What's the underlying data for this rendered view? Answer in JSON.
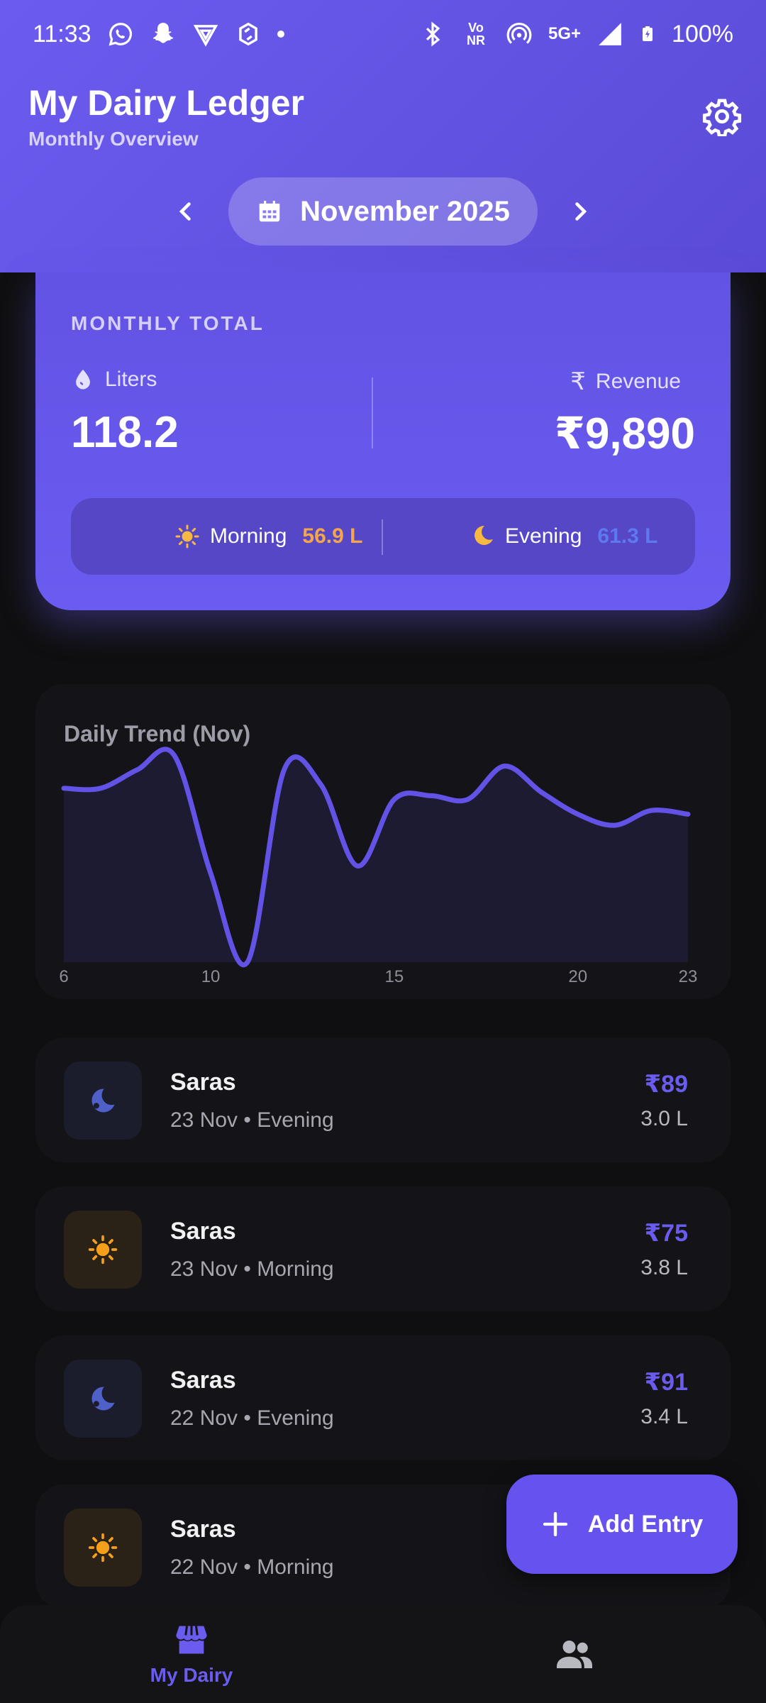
{
  "status_bar": {
    "time": "11:33",
    "network": "5G+",
    "volte": "Vo NR",
    "battery": "100%",
    "icons": [
      "whatsapp-icon",
      "snapchat-icon",
      "vpn-icon",
      "sync-icon",
      "dot-icon",
      "bluetooth-icon",
      "volte-icon",
      "hotspot-icon",
      "network-icon",
      "signal-icon",
      "battery-icon"
    ]
  },
  "header": {
    "title": "My Dairy Ledger",
    "subtitle": "Monthly Overview",
    "settings_icon": "gear-icon",
    "month_label": "November 2025",
    "calendar_icon": "calendar-icon",
    "prev_icon": "chevron-left-icon",
    "next_icon": "chevron-right-icon"
  },
  "monthly_total": {
    "caption": "MONTHLY TOTAL",
    "liters_label": "Liters",
    "liters_value": "118.2",
    "revenue_label": "Revenue",
    "revenue_value": "₹9,890",
    "morning_label": "Morning",
    "morning_value": "56.9 L",
    "evening_label": "Evening",
    "evening_value": "61.3 L",
    "colors": {
      "morning": "#f5a64a",
      "evening": "#5e79f0"
    }
  },
  "chart": {
    "title": "Daily Trend (Nov)",
    "tick_labels": [
      "6",
      "10",
      "15",
      "20",
      "23"
    ]
  },
  "chart_data": {
    "type": "area",
    "title": "Daily Trend (Nov)",
    "x": [
      6,
      7,
      8,
      9,
      10,
      11,
      12,
      13,
      14,
      15,
      16,
      17,
      18,
      19,
      20,
      21,
      22,
      23
    ],
    "series": [
      {
        "values": [
          4.7,
          4.7,
          5.2,
          5.6,
          2.4,
          0.0,
          5.2,
          4.8,
          2.6,
          4.4,
          4.5,
          4.4,
          5.3,
          4.6,
          4.0,
          3.7,
          4.1,
          4.0
        ]
      }
    ],
    "xticks": [
      6,
      10,
      15,
      20,
      23
    ],
    "grid": false,
    "color": "#6352e6"
  },
  "entries": [
    {
      "name": "Saras",
      "meta": "23 Nov • Evening",
      "amount": "₹89",
      "liters": "3.0 L",
      "shift": "evening"
    },
    {
      "name": "Saras",
      "meta": "23 Nov • Morning",
      "amount": "₹75",
      "liters": "3.8 L",
      "shift": "morning"
    },
    {
      "name": "Saras",
      "meta": "22 Nov • Evening",
      "amount": "₹91",
      "liters": "3.4 L",
      "shift": "evening"
    },
    {
      "name": "Saras",
      "meta": "22 Nov • Morning",
      "amount": "",
      "liters": "",
      "shift": "morning"
    }
  ],
  "fab": {
    "label": "Add Entry",
    "icon": "plus-icon"
  },
  "bottom_nav": {
    "items": [
      {
        "label": "My Dairy",
        "icon": "store-icon",
        "active": true
      },
      {
        "label": "",
        "icon": "people-icon",
        "active": false
      }
    ]
  }
}
